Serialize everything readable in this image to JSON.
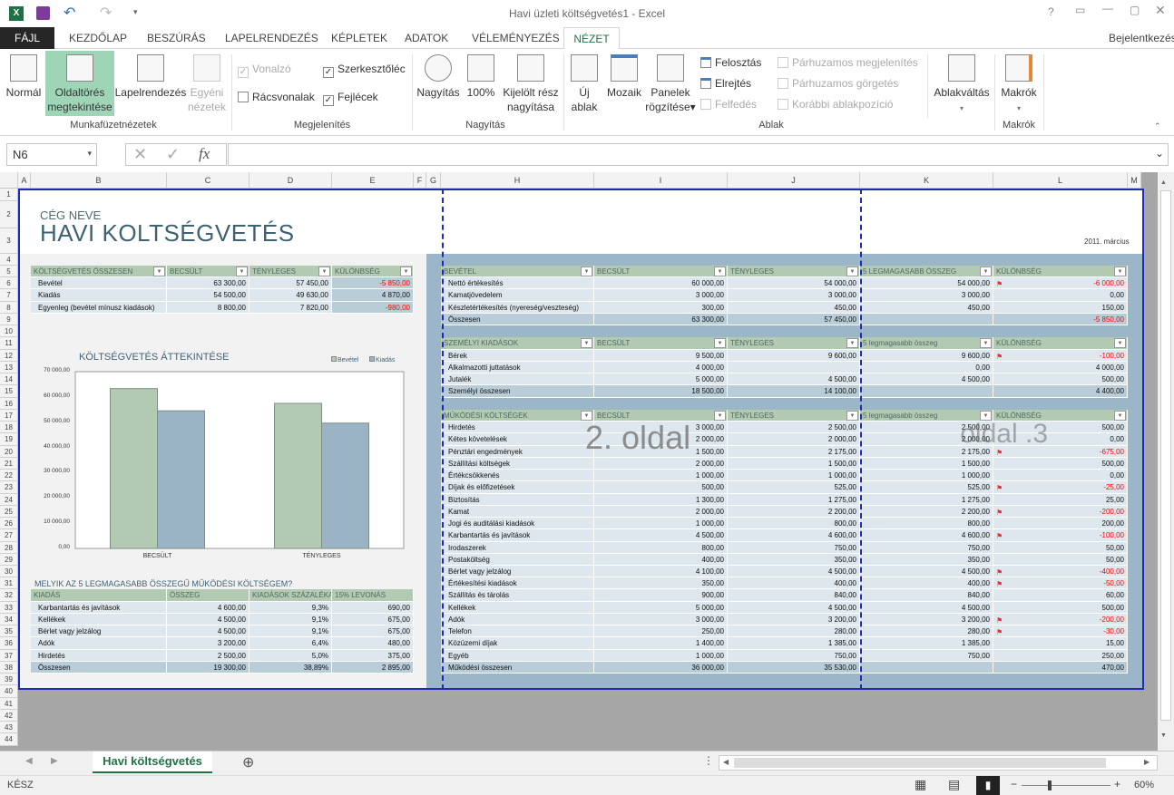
{
  "window": {
    "title": "Havi üzleti költségvetés1 - Excel",
    "signin": "Bejelentkezés"
  },
  "qat": {
    "icons": [
      "excel-icon",
      "save-icon",
      "undo-icon",
      "redo-icon",
      "customize-icon"
    ]
  },
  "tabs": [
    "FÁJL",
    "KEZDŐLAP",
    "BESZÚRÁS",
    "LAPELRENDEZÉS",
    "KÉPLETEK",
    "ADATOK",
    "VÉLEMÉNYEZÉS",
    "NÉZET"
  ],
  "active_tab": "NÉZET",
  "ribbon": {
    "views": {
      "label": "Munkafüzetnézetek",
      "normal": "Normál",
      "pagebreak1": "Oldaltörés",
      "pagebreak2": "megtekintése",
      "layout": "Lapelrendezés",
      "custom1": "Egyéni",
      "custom2": "nézetek"
    },
    "show": {
      "label": "Megjelenítés",
      "ruler": "Vonalzó",
      "formula_bar": "Szerkesztőléc",
      "gridlines": "Rácsvonalak",
      "headings": "Fejlécek",
      "ruler_checked": true,
      "formula_bar_checked": true,
      "gridlines_checked": false,
      "headings_checked": true
    },
    "zoom": {
      "label": "Nagyítás",
      "zoom": "Nagyítás",
      "hundred": "100%",
      "sel1": "Kijelölt rész",
      "sel2": "nagyítása"
    },
    "window": {
      "label": "Ablak",
      "new1": "Új",
      "new2": "ablak",
      "arrange": "Mozaik",
      "freeze1": "Panelek",
      "freeze2": "rögzítése",
      "split": "Felosztás",
      "hide": "Elrejtés",
      "unhide": "Felfedés",
      "side": "Párhuzamos megjelenítés",
      "sync": "Párhuzamos görgetés",
      "reset": "Korábbi ablakpozíció",
      "switch": "Ablakváltás"
    },
    "macros": {
      "label": "Makrók",
      "macros": "Makrók"
    }
  },
  "formula_bar": {
    "name_box": "N6",
    "fx": "fx",
    "value": ""
  },
  "columns": [
    "A",
    "B",
    "C",
    "D",
    "E",
    "F",
    "G",
    "H",
    "I",
    "J",
    "K",
    "L",
    "M"
  ],
  "sheet": {
    "company": "CÉG NEVE",
    "title": "HAVI KOLTSÉGVETÉS",
    "date": "2011. március",
    "watermark2": "2. oldal",
    "watermark3": "3. oldal",
    "summary": {
      "headers": [
        "KÖLTSÉGVETÉS ÖSSZESEN",
        "BECSÜLT",
        "TÉNYLEGES",
        "KÜLÖNBSÉG"
      ],
      "rows": [
        [
          "Bevétel",
          "63 300,00",
          "57 450,00",
          "-5 850,00"
        ],
        [
          "Kiadás",
          "54 500,00",
          "49 630,00",
          "4 870,00"
        ],
        [
          "Egyenleg (bevétel mínusz kiadások)",
          "8 800,00",
          "7 820,00",
          "-980,00"
        ]
      ]
    },
    "top5_title": "MELYIK AZ 5 LEGMAGASABB ÖSSZEGŰ MŰKÖDÉSI KÖLTSÉGEM?",
    "top5": {
      "headers": [
        "KIADÁS",
        "ÖSSZEG",
        "KIADÁSOK SZÁZALÉKA",
        "15% LEVONÁS"
      ],
      "rows": [
        [
          "Karbantartás és javítások",
          "4 600,00",
          "9,3%",
          "690,00"
        ],
        [
          "Kellékek",
          "4 500,00",
          "9,1%",
          "675,00"
        ],
        [
          "Bérlet vagy jelzálog",
          "4 500,00",
          "9,1%",
          "675,00"
        ],
        [
          "Adók",
          "3 200,00",
          "6,4%",
          "480,00"
        ],
        [
          "Hirdetés",
          "2 500,00",
          "5,0%",
          "375,00"
        ]
      ],
      "total": [
        "Összesen",
        "19 300,00",
        "38,89%",
        "2 895,00"
      ]
    },
    "income": {
      "headers": [
        "BEVÉTEL",
        "BECSÜLT",
        "TÉNYLEGES",
        "5 LEGMAGASABB ÖSSZEG",
        "KÜLÖNBSÉG"
      ],
      "rows": [
        [
          "Nettó értékesítés",
          "60 000,00",
          "54 000,00",
          "54 000,00",
          "-6 000,00"
        ],
        [
          "Kamatjövedelem",
          "3 000,00",
          "3 000,00",
          "3 000,00",
          "0,00"
        ],
        [
          "Készletértékesítés (nyereség/veszteség)",
          "300,00",
          "450,00",
          "450,00",
          "150,00"
        ]
      ],
      "total": [
        "Összesen",
        "63 300,00",
        "57 450,00",
        "",
        "-5 850,00"
      ]
    },
    "personal": {
      "headers": [
        "SZEMÉLYI KIADÁSOK",
        "BECSÜLT",
        "TÉNYLEGES",
        "5 legmagasabb összeg",
        "KÜLÖNBSÉG"
      ],
      "rows": [
        [
          "Bérek",
          "9 500,00",
          "9 600,00",
          "9 600,00",
          "-100,00"
        ],
        [
          "Alkalmazotti juttatások",
          "4 000,00",
          "",
          "0,00",
          "4 000,00"
        ],
        [
          "Jutalék",
          "5 000,00",
          "4 500,00",
          "4 500,00",
          "500,00"
        ]
      ],
      "total": [
        "Személyi összesen",
        "18 500,00",
        "14 100,00",
        "",
        "4 400,00"
      ]
    },
    "operating": {
      "headers": [
        "MŰKÖDÉSI KÖLTSÉGEK",
        "BECSÜLT",
        "TÉNYLEGES",
        "5 legmagasabb összeg",
        "KÜLÖNBSÉG"
      ],
      "rows": [
        [
          "Hirdetés",
          "3 000,00",
          "2 500,00",
          "2 500,00",
          "500,00"
        ],
        [
          "Kétes követelések",
          "2 000,00",
          "2 000,00",
          "2 000,00",
          "0,00"
        ],
        [
          "Pénztári engedmények",
          "1 500,00",
          "2 175,00",
          "2 175,00",
          "-675,00"
        ],
        [
          "Szállítási költségek",
          "2 000,00",
          "1 500,00",
          "1 500,00",
          "500,00"
        ],
        [
          "Értékcsökkenés",
          "1 000,00",
          "1 000,00",
          "1 000,00",
          "0,00"
        ],
        [
          "Díjak és előfizetések",
          "500,00",
          "525,00",
          "525,00",
          "-25,00"
        ],
        [
          "Biztosítás",
          "1 300,00",
          "1 275,00",
          "1 275,00",
          "25,00"
        ],
        [
          "Kamat",
          "2 000,00",
          "2 200,00",
          "2 200,00",
          "-200,00"
        ],
        [
          "Jogi és auditálási kiadások",
          "1 000,00",
          "800,00",
          "800,00",
          "200,00"
        ],
        [
          "Karbantartás és javítások",
          "4 500,00",
          "4 600,00",
          "4 600,00",
          "-100,00"
        ],
        [
          "Irodaszerek",
          "800,00",
          "750,00",
          "750,00",
          "50,00"
        ],
        [
          "Postaköltség",
          "400,00",
          "350,00",
          "350,00",
          "50,00"
        ],
        [
          "Bérlet vagy jelzálog",
          "4 100,00",
          "4 500,00",
          "4 500,00",
          "-400,00"
        ],
        [
          "Értékesítési kiadások",
          "350,00",
          "400,00",
          "400,00",
          "-50,00"
        ],
        [
          "Szállítás és tárolás",
          "900,00",
          "840,00",
          "840,00",
          "60,00"
        ],
        [
          "Kellékek",
          "5 000,00",
          "4 500,00",
          "4 500,00",
          "500,00"
        ],
        [
          "Adók",
          "3 000,00",
          "3 200,00",
          "3 200,00",
          "-200,00"
        ],
        [
          "Telefon",
          "250,00",
          "280,00",
          "280,00",
          "-30,00"
        ],
        [
          "Közüzemi díjak",
          "1 400,00",
          "1 385,00",
          "1 385,00",
          "15,00"
        ],
        [
          "Egyéb",
          "1 000,00",
          "750,00",
          "750,00",
          "250,00"
        ]
      ],
      "total": [
        "Működési összesen",
        "36 000,00",
        "35 530,00",
        "",
        "470,00"
      ]
    }
  },
  "chart_data": {
    "type": "bar",
    "title": "KÖLTSÉGVETÉS ÁTTEKINTÉSE",
    "categories": [
      "BECSÜLT",
      "TÉNYLEGES"
    ],
    "series": [
      {
        "name": "Bevétel",
        "values": [
          63300,
          57450
        ],
        "color": "#b2c9b2"
      },
      {
        "name": "Kiadás",
        "values": [
          54500,
          49630
        ],
        "color": "#9ab4c6"
      }
    ],
    "ylim": [
      0,
      70000
    ],
    "yticks": [
      "0,00",
      "10 000,00",
      "20 000,00",
      "30 000,00",
      "40 000,00",
      "50 000,00",
      "60 000,00",
      "70 000,00"
    ],
    "legend": "top-right",
    "grid": false
  },
  "sheet_tabs": [
    {
      "label": "Havi költségvetés",
      "active": true
    }
  ],
  "status": {
    "ready": "KÉSZ",
    "zoom": "60%",
    "zoom_fraction": 0.6
  }
}
